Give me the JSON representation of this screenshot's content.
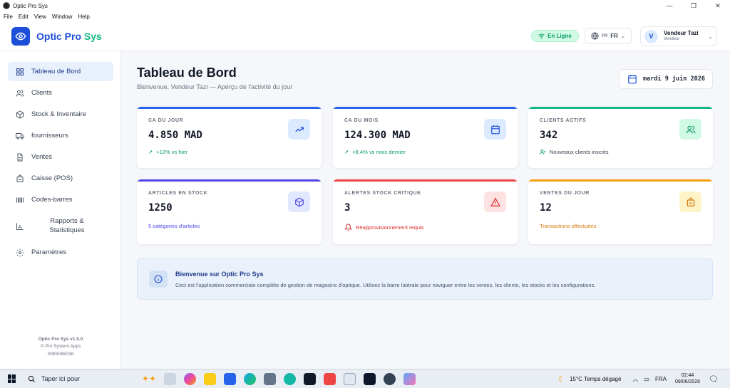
{
  "window": {
    "title": "Optic Pro Sys",
    "menu": [
      "File",
      "Edit",
      "View",
      "Window",
      "Help"
    ],
    "controls": [
      "—",
      "❐",
      "✕"
    ]
  },
  "header": {
    "brand_main": "Optic Pro ",
    "brand_accent": "Sys",
    "status": "En Ligne",
    "lang_small": "FR",
    "lang": "FR",
    "user_initial": "V",
    "user_name": "Vendeur Tazi",
    "user_role": "Vendeur"
  },
  "sidebar": {
    "items": [
      {
        "label": "Tableau de Bord",
        "icon": "grid-icon",
        "active": true
      },
      {
        "label": "Clients",
        "icon": "users-icon"
      },
      {
        "label": "Stock & Inventaire",
        "icon": "box-icon"
      },
      {
        "label": "fournisseurs",
        "icon": "truck-icon"
      },
      {
        "label": "Ventes",
        "icon": "document-icon"
      },
      {
        "label": "Caisse (POS)",
        "icon": "bag-icon"
      },
      {
        "label": "Codes-barres",
        "icon": "barcode-icon"
      },
      {
        "label": "Rapports & Statistiques",
        "label_l1": "Rapports &",
        "label_l2": "Statistiques",
        "icon": "chart-icon"
      },
      {
        "label": "Paramètres",
        "icon": "gear-icon"
      }
    ],
    "footer_version": "Optic Pro Sys v1.0.0",
    "footer_company": "© Pro System Apps",
    "footer_code": "0083088038"
  },
  "main": {
    "title": "Tableau de Bord",
    "subtitle": "Bienvenue, Vendeur Tazi — Aperçu de l'activité du jour",
    "date": "mardi 9 juin 2026",
    "cards": [
      {
        "label": "CA DU JOUR",
        "value": "4.850 MAD",
        "sub": "+12% vs hier",
        "accent": "#2563eb",
        "sub_color": "#059669",
        "icon": "trending-up-icon"
      },
      {
        "label": "CA DU MOIS",
        "value": "124.300 MAD",
        "sub": "+8.4% vs mois dernier",
        "accent": "#2563eb",
        "sub_color": "#059669",
        "icon": "calendar-icon"
      },
      {
        "label": "CLIENTS ACTIFS",
        "value": "342",
        "sub": "Nouveaux clients inscrits",
        "accent": "#10b981",
        "sub_color": "#374151",
        "icon": "users-icon"
      },
      {
        "label": "ARTICLES EN STOCK",
        "value": "1250",
        "sub": "5 catégories d'articles",
        "accent": "#4f46e5",
        "sub_color": "#4f46e5",
        "icon": "cube-icon"
      },
      {
        "label": "ALERTES STOCK CRITIQUE",
        "value": "3",
        "sub": "Réapprovisionnement requis",
        "accent": "#ef4444",
        "sub_color": "#dc2626",
        "icon": "warning-icon"
      },
      {
        "label": "VENTES DU JOUR",
        "value": "12",
        "sub": "Transactions effectuées",
        "accent": "#f59e0b",
        "sub_color": "#d97706",
        "icon": "shopping-bag-icon"
      }
    ],
    "info": {
      "title": "Bienvenue sur Optic Pro Sys",
      "text": "Ceci est l'application commerciale complète de gestion de magasins d'optique. Utilisez la barre latérale pour naviguer entre les ventes, les clients, les stocks et les configurations."
    }
  },
  "taskbar": {
    "search_placeholder": "Taper ici pour",
    "weather": "15°C  Temps dégagé",
    "lang": "FRA",
    "time": "02:44",
    "date": "09/06/2026"
  }
}
